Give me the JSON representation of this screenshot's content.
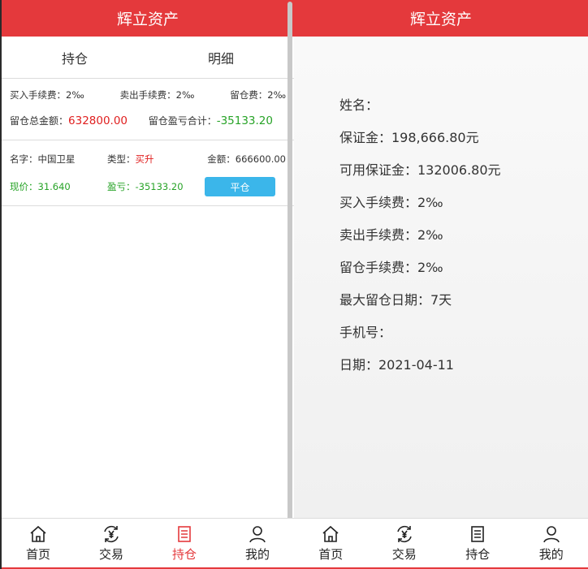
{
  "app_title": "辉立资产",
  "left": {
    "tabs": [
      "持仓",
      "明细"
    ],
    "fees": {
      "buy_fee": "买入手续费：2‰",
      "sell_fee": "卖出手续费：2‰",
      "hold_fee": "留仓费：2‰"
    },
    "summary": {
      "total_label": "留仓总金额：",
      "total_value": "632800.00",
      "pl_label": "留仓盈亏合计：",
      "pl_value": "-35133.20"
    },
    "position": {
      "name": "名字：中国卫星",
      "type_label": "类型：",
      "type_value": "买升",
      "amount": "金额：666600.00",
      "price": "现价：31.640",
      "pl": "盈亏：-35133.20",
      "close_button": "平仓"
    }
  },
  "right": {
    "info": [
      "姓名：",
      "保证金：198,666.80元",
      "可用保证金：132006.80元",
      "买入手续费：2‰",
      "卖出手续费：2‰",
      "留仓手续费：2‰",
      "最大留仓日期：7天",
      "手机号：",
      "日期：2021-04-11"
    ]
  },
  "nav": [
    "首页",
    "交易",
    "持仓",
    "我的"
  ],
  "colors": {
    "brand_red": "#e4393c",
    "button_blue": "#3bb6ea",
    "green": "#27a327"
  }
}
